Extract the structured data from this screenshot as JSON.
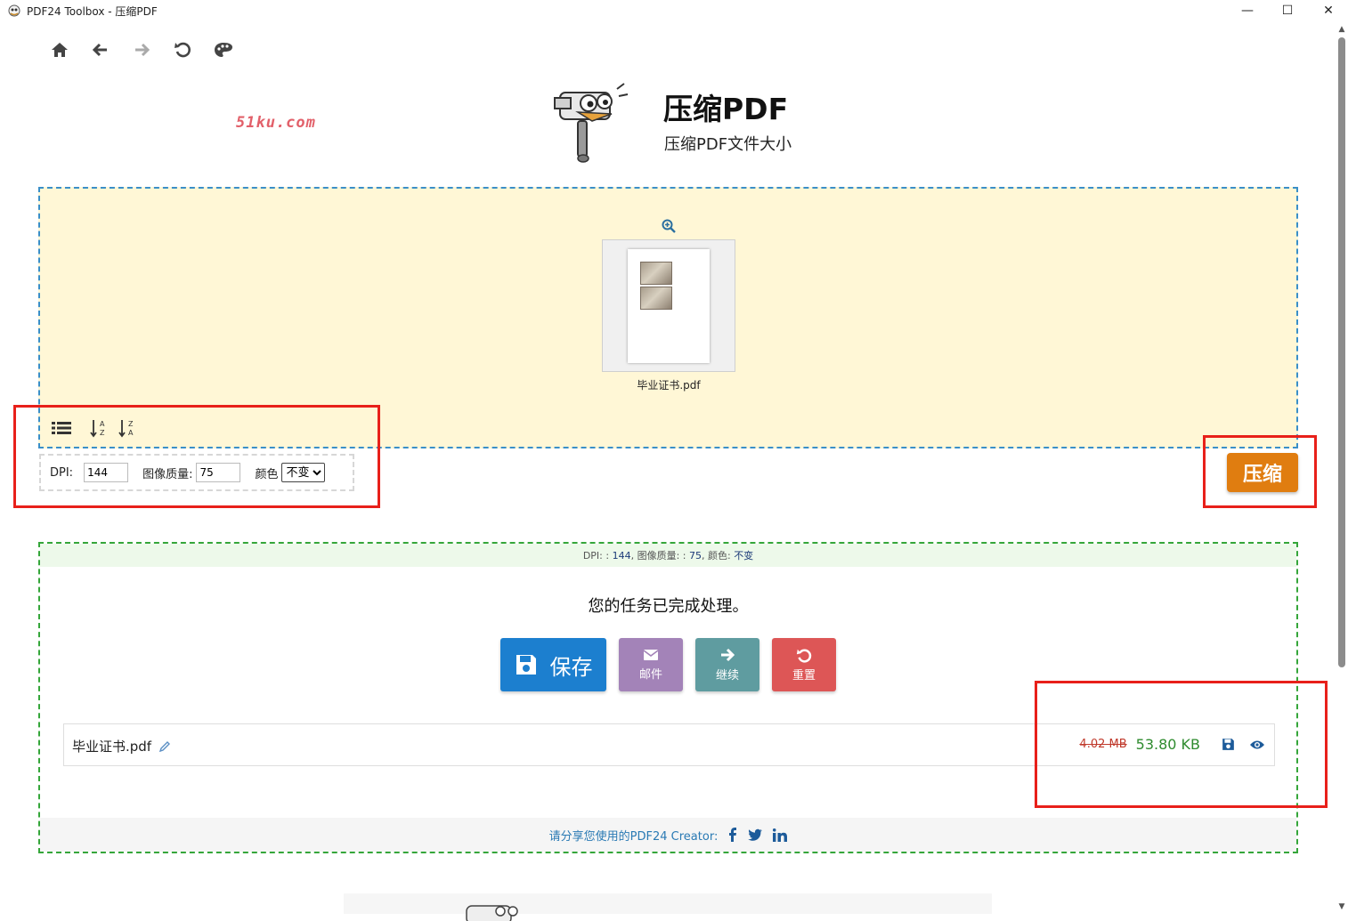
{
  "window": {
    "title": "PDF24 Toolbox - 压缩PDF",
    "minimize": "—",
    "maximize": "☐",
    "close": "✕"
  },
  "toolbar": {
    "icons": [
      "home-icon",
      "back-arrow-icon",
      "forward-arrow-icon",
      "reload-icon",
      "palette-icon"
    ]
  },
  "header": {
    "title": "压缩PDF",
    "subtitle": "压缩PDF文件大小"
  },
  "watermark": "51ku.com",
  "dropzone": {
    "file_name": "毕业证书.pdf"
  },
  "options": {
    "dpi_label": "DPI:",
    "dpi_value": "144",
    "quality_label": "图像质量:",
    "quality_value": "75",
    "color_label": "颜色",
    "color_selected": "不变"
  },
  "compress_button": "压缩",
  "result": {
    "settings": {
      "dpi_label": "DPI: :",
      "dpi_value": "144",
      "quality_label": ", 图像质量: :",
      "quality_value": "75",
      "color_label": ", 颜色:",
      "color_value": "不变"
    },
    "done_message": "您的任务已完成处理。",
    "actions": {
      "save": "保存",
      "mail": "邮件",
      "continue": "继续",
      "reset": "重置"
    },
    "file": {
      "name": "毕业证书.pdf",
      "old_size": "4.02 MB",
      "new_size": "53.80 KB"
    },
    "share_text": "请分享您使用的PDF24 Creator:"
  },
  "colors": {
    "accent_orange": "#e07d10",
    "save_blue": "#1c7fcf",
    "mail_purple": "#a383b8",
    "continue_teal": "#5f9ca0",
    "reset_red": "#dd5656",
    "highlight_red": "#e8201a"
  }
}
